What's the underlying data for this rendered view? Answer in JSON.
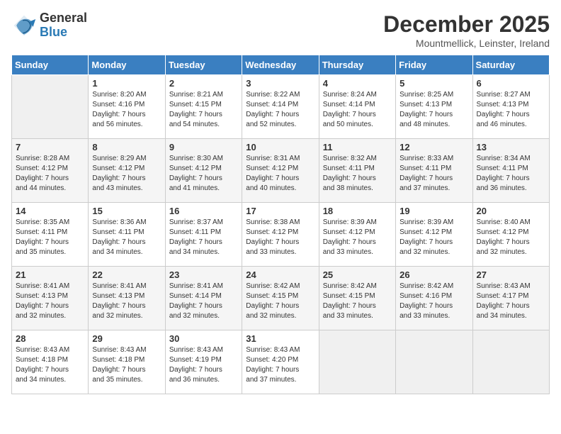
{
  "header": {
    "logo_line1": "General",
    "logo_line2": "Blue",
    "title": "December 2025",
    "subtitle": "Mountmellick, Leinster, Ireland"
  },
  "days_of_week": [
    "Sunday",
    "Monday",
    "Tuesday",
    "Wednesday",
    "Thursday",
    "Friday",
    "Saturday"
  ],
  "weeks": [
    [
      {
        "day": "",
        "info": ""
      },
      {
        "day": "1",
        "info": "Sunrise: 8:20 AM\nSunset: 4:16 PM\nDaylight: 7 hours\nand 56 minutes."
      },
      {
        "day": "2",
        "info": "Sunrise: 8:21 AM\nSunset: 4:15 PM\nDaylight: 7 hours\nand 54 minutes."
      },
      {
        "day": "3",
        "info": "Sunrise: 8:22 AM\nSunset: 4:14 PM\nDaylight: 7 hours\nand 52 minutes."
      },
      {
        "day": "4",
        "info": "Sunrise: 8:24 AM\nSunset: 4:14 PM\nDaylight: 7 hours\nand 50 minutes."
      },
      {
        "day": "5",
        "info": "Sunrise: 8:25 AM\nSunset: 4:13 PM\nDaylight: 7 hours\nand 48 minutes."
      },
      {
        "day": "6",
        "info": "Sunrise: 8:27 AM\nSunset: 4:13 PM\nDaylight: 7 hours\nand 46 minutes."
      }
    ],
    [
      {
        "day": "7",
        "info": "Sunrise: 8:28 AM\nSunset: 4:12 PM\nDaylight: 7 hours\nand 44 minutes."
      },
      {
        "day": "8",
        "info": "Sunrise: 8:29 AM\nSunset: 4:12 PM\nDaylight: 7 hours\nand 43 minutes."
      },
      {
        "day": "9",
        "info": "Sunrise: 8:30 AM\nSunset: 4:12 PM\nDaylight: 7 hours\nand 41 minutes."
      },
      {
        "day": "10",
        "info": "Sunrise: 8:31 AM\nSunset: 4:12 PM\nDaylight: 7 hours\nand 40 minutes."
      },
      {
        "day": "11",
        "info": "Sunrise: 8:32 AM\nSunset: 4:11 PM\nDaylight: 7 hours\nand 38 minutes."
      },
      {
        "day": "12",
        "info": "Sunrise: 8:33 AM\nSunset: 4:11 PM\nDaylight: 7 hours\nand 37 minutes."
      },
      {
        "day": "13",
        "info": "Sunrise: 8:34 AM\nSunset: 4:11 PM\nDaylight: 7 hours\nand 36 minutes."
      }
    ],
    [
      {
        "day": "14",
        "info": "Sunrise: 8:35 AM\nSunset: 4:11 PM\nDaylight: 7 hours\nand 35 minutes."
      },
      {
        "day": "15",
        "info": "Sunrise: 8:36 AM\nSunset: 4:11 PM\nDaylight: 7 hours\nand 34 minutes."
      },
      {
        "day": "16",
        "info": "Sunrise: 8:37 AM\nSunset: 4:11 PM\nDaylight: 7 hours\nand 34 minutes."
      },
      {
        "day": "17",
        "info": "Sunrise: 8:38 AM\nSunset: 4:12 PM\nDaylight: 7 hours\nand 33 minutes."
      },
      {
        "day": "18",
        "info": "Sunrise: 8:39 AM\nSunset: 4:12 PM\nDaylight: 7 hours\nand 33 minutes."
      },
      {
        "day": "19",
        "info": "Sunrise: 8:39 AM\nSunset: 4:12 PM\nDaylight: 7 hours\nand 32 minutes."
      },
      {
        "day": "20",
        "info": "Sunrise: 8:40 AM\nSunset: 4:12 PM\nDaylight: 7 hours\nand 32 minutes."
      }
    ],
    [
      {
        "day": "21",
        "info": "Sunrise: 8:41 AM\nSunset: 4:13 PM\nDaylight: 7 hours\nand 32 minutes."
      },
      {
        "day": "22",
        "info": "Sunrise: 8:41 AM\nSunset: 4:13 PM\nDaylight: 7 hours\nand 32 minutes."
      },
      {
        "day": "23",
        "info": "Sunrise: 8:41 AM\nSunset: 4:14 PM\nDaylight: 7 hours\nand 32 minutes."
      },
      {
        "day": "24",
        "info": "Sunrise: 8:42 AM\nSunset: 4:15 PM\nDaylight: 7 hours\nand 32 minutes."
      },
      {
        "day": "25",
        "info": "Sunrise: 8:42 AM\nSunset: 4:15 PM\nDaylight: 7 hours\nand 33 minutes."
      },
      {
        "day": "26",
        "info": "Sunrise: 8:42 AM\nSunset: 4:16 PM\nDaylight: 7 hours\nand 33 minutes."
      },
      {
        "day": "27",
        "info": "Sunrise: 8:43 AM\nSunset: 4:17 PM\nDaylight: 7 hours\nand 34 minutes."
      }
    ],
    [
      {
        "day": "28",
        "info": "Sunrise: 8:43 AM\nSunset: 4:18 PM\nDaylight: 7 hours\nand 34 minutes."
      },
      {
        "day": "29",
        "info": "Sunrise: 8:43 AM\nSunset: 4:18 PM\nDaylight: 7 hours\nand 35 minutes."
      },
      {
        "day": "30",
        "info": "Sunrise: 8:43 AM\nSunset: 4:19 PM\nDaylight: 7 hours\nand 36 minutes."
      },
      {
        "day": "31",
        "info": "Sunrise: 8:43 AM\nSunset: 4:20 PM\nDaylight: 7 hours\nand 37 minutes."
      },
      {
        "day": "",
        "info": ""
      },
      {
        "day": "",
        "info": ""
      },
      {
        "day": "",
        "info": ""
      }
    ]
  ]
}
